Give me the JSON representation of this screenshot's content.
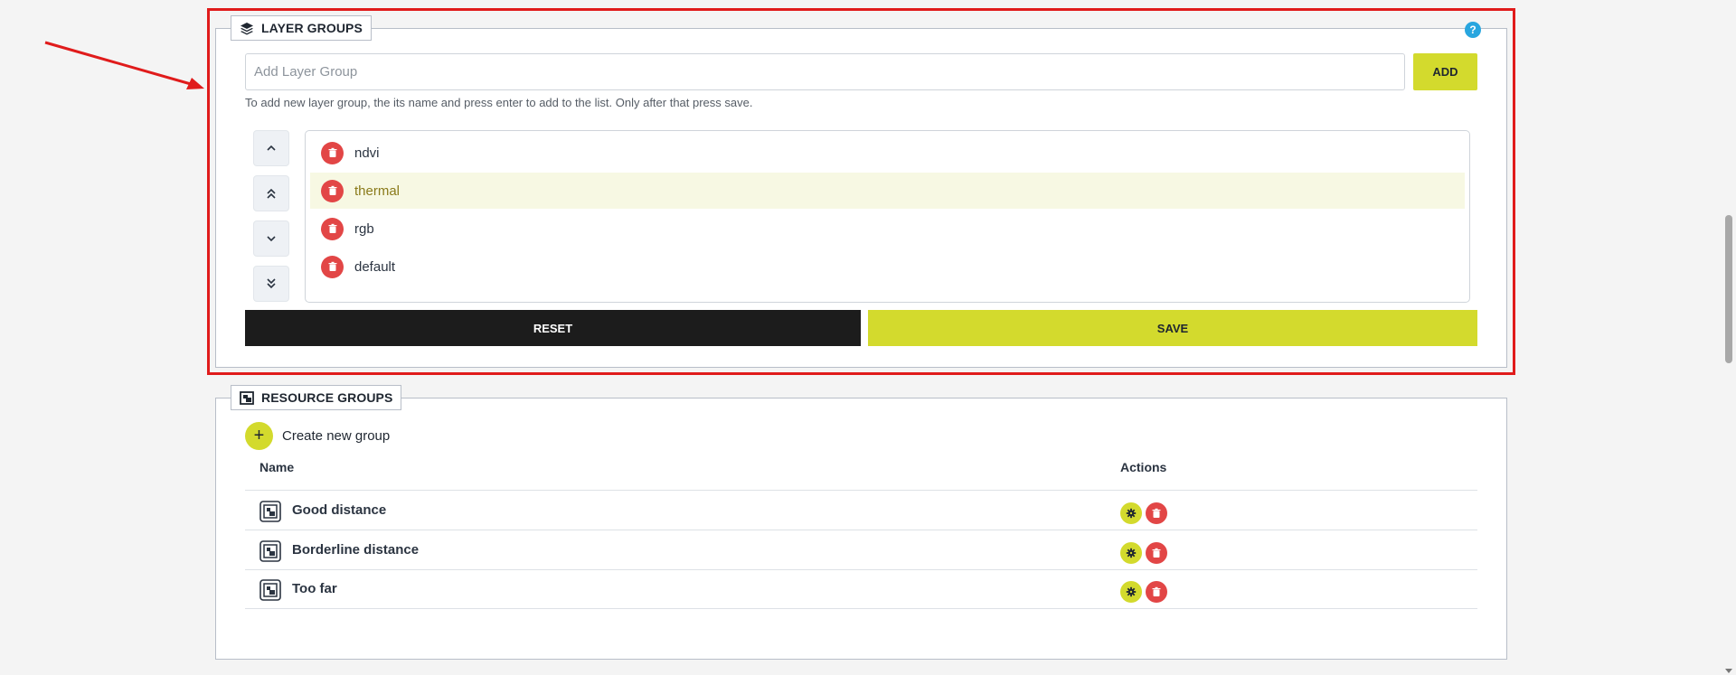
{
  "layer_groups": {
    "title": "LAYER GROUPS",
    "help_icon": "?",
    "input_placeholder": "Add Layer Group",
    "add_label": "ADD",
    "hint": "To add new layer group, the its name and press enter to add to the list. Only after that press save.",
    "items": [
      {
        "label": "ndvi",
        "selected": false
      },
      {
        "label": "thermal",
        "selected": true
      },
      {
        "label": "rgb",
        "selected": false
      },
      {
        "label": "default",
        "selected": false
      }
    ],
    "reset_label": "RESET",
    "save_label": "SAVE"
  },
  "resource_groups": {
    "title": "RESOURCE GROUPS",
    "create_label": "Create new group",
    "columns": {
      "name": "Name",
      "actions": "Actions"
    },
    "rows": [
      {
        "name": "Good distance"
      },
      {
        "name": "Borderline distance"
      },
      {
        "name": "Too far"
      }
    ]
  },
  "colors": {
    "accent": "#d3da2d",
    "danger": "#e24646",
    "annotation": "#e01b1b",
    "info": "#29a6df"
  },
  "icons": {
    "layers": "layers-icon",
    "resource": "image-gallery-icon",
    "delete": "trash-icon",
    "settings": "gear-icon",
    "move": [
      "chevron-up-icon",
      "double-chevron-up-icon",
      "chevron-down-icon",
      "double-chevron-down-icon"
    ]
  }
}
